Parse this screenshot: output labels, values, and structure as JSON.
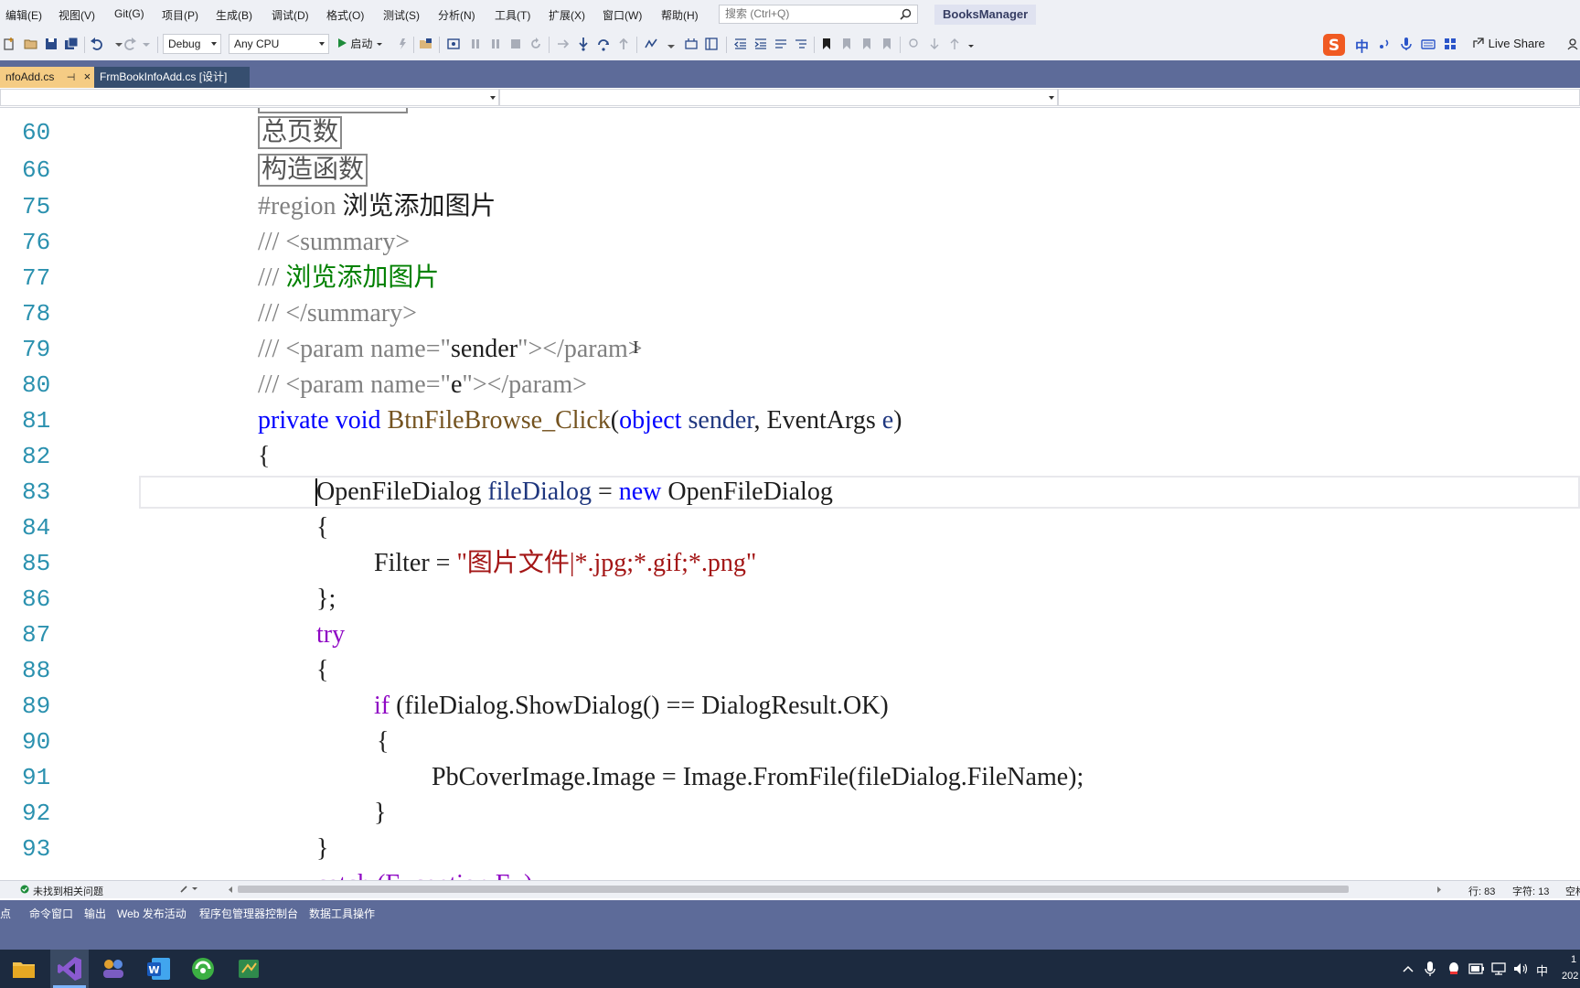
{
  "menu": {
    "items": [
      "编辑(E)",
      "视图(V)",
      "Git(G)",
      "项目(P)",
      "生成(B)",
      "调试(D)",
      "格式(O)",
      "测试(S)",
      "分析(N)",
      "工具(T)",
      "扩展(X)",
      "窗口(W)",
      "帮助(H)"
    ],
    "search_placeholder": "搜索 (Ctrl+Q)",
    "solution_name": "BooksManager"
  },
  "toolbar": {
    "config": "Debug",
    "platform": "Any CPU",
    "start_label": "启动",
    "live_share": "Live Share",
    "ime_label": "中"
  },
  "tabs": {
    "active": "nfoAdd.cs",
    "pin_glyph": "⊣",
    "close_glyph": "×",
    "designer": "FrmBookInfoAdd.cs [设计]"
  },
  "editor": {
    "line_numbers": [
      "60",
      "66",
      "75",
      "76",
      "77",
      "78",
      "79",
      "80",
      "81",
      "82",
      "83",
      "84",
      "85",
      "86",
      "87",
      "88",
      "89",
      "90",
      "91",
      "92",
      "93"
    ],
    "collapsed_regions": [
      "总页数",
      "构造函数"
    ],
    "code": {
      "l75_kw": "#region",
      "l75_text": "浏览添加图片",
      "l76": "/// <summary>",
      "l77_prefix": "///",
      "l77_text": "浏览添加图片",
      "l78": "/// </summary>",
      "l79_a": "/// <param name=\"",
      "l79_b": "sender",
      "l79_c": "\"></param>",
      "l80_a": "/// <param name=\"",
      "l80_b": "e",
      "l80_c": "\"></param>",
      "l81_private": "private",
      "l81_void": "void",
      "l81_method": "BtnFileBrowse_Click",
      "l81_open": "(",
      "l81_object": "object",
      "l81_sender": "sender",
      "l81_comma": ",",
      "l81_eventargs": "EventArgs",
      "l81_e": "e",
      "l81_close": ")",
      "brace_open": "{",
      "brace_close": "}",
      "l83_type": "OpenFileDialog",
      "l83_var": "fileDialog",
      "l83_eq": "=",
      "l83_new": "new",
      "l83_type2": "OpenFileDialog",
      "l85_filter": "Filter =",
      "l85_str": "\"图片文件|*.jpg;*.gif;*.png\"",
      "l86": "};",
      "l87": "try",
      "l89_if": "if",
      "l89_rest": "(fileDialog.ShowDialog() == DialogResult.OK)",
      "l91": "PbCoverImage.Image = Image.FromFile(fileDialog.FileName);",
      "l94_partial": "catch (Exception Ex)"
    }
  },
  "editor_status": {
    "issues": "未找到相关问题",
    "line": "行: 83",
    "char": "字符: 13",
    "mode": "空格"
  },
  "toolwindows": {
    "tabs": [
      "断点",
      "命令窗口",
      "输出",
      "Web 发布活动",
      "程序包管理器控制台",
      "数据工具操作"
    ]
  },
  "taskbar": {
    "tray_ime": "中",
    "clock_partial": "1",
    "date_partial": "202"
  },
  "colors": {
    "accent_tab": "#f5cc84",
    "chrome_blue": "#5d6b99",
    "line_number": "#2b91af",
    "keyword": "#0000ff",
    "string": "#a31515",
    "comment": "#808080"
  }
}
